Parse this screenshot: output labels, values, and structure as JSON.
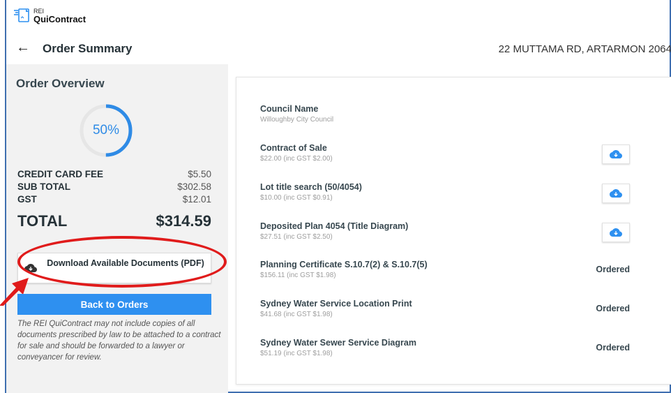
{
  "logo": {
    "small": "REI",
    "big": "QuiContract"
  },
  "header": {
    "title": "Order Summary",
    "address": "22 MUTTAMA RD, ARTARMON 2064"
  },
  "overview": {
    "title": "Order Overview",
    "progress_label": "50%",
    "progress_fraction": 0.5,
    "accent": "#2f8be6",
    "fees": [
      {
        "label": "CREDIT CARD FEE",
        "value": "$5.50"
      },
      {
        "label": "SUB TOTAL",
        "value": "$302.58"
      },
      {
        "label": "GST",
        "value": "$12.01"
      }
    ],
    "total_label": "TOTAL",
    "total_value": "$314.59",
    "download_label": "Download Available Documents (PDF)",
    "back_label": "Back to Orders",
    "note": "The REI QuiContract may not include copies of all documents prescribed by law to be attached to a contract for sale and should be forwarded to a lawyer or conveyancer for review."
  },
  "items": [
    {
      "name": "Council Name",
      "sub": "Willoughby City Council",
      "action": ""
    },
    {
      "name": "Contract of Sale",
      "sub": "$22.00 (inc GST $2.00)",
      "action": "download-icon"
    },
    {
      "name": "Lot title search (50/4054)",
      "sub": "$10.00 (inc GST $0.91)",
      "action": "download-icon"
    },
    {
      "name": "Deposited Plan 4054 (Title Diagram)",
      "sub": "$27.51 (inc GST $2.50)",
      "action": "download-icon"
    },
    {
      "name": "Planning Certificate S.10.7(2) & S.10.7(5)",
      "sub": "$156.11 (inc GST $1.98)",
      "action": "Ordered"
    },
    {
      "name": "Sydney Water Service Location Print",
      "sub": "$41.68 (inc GST $1.98)",
      "action": "Ordered"
    },
    {
      "name": "Sydney Water Sewer Service Diagram",
      "sub": "$51.19 (inc GST $1.98)",
      "action": "Ordered"
    }
  ]
}
